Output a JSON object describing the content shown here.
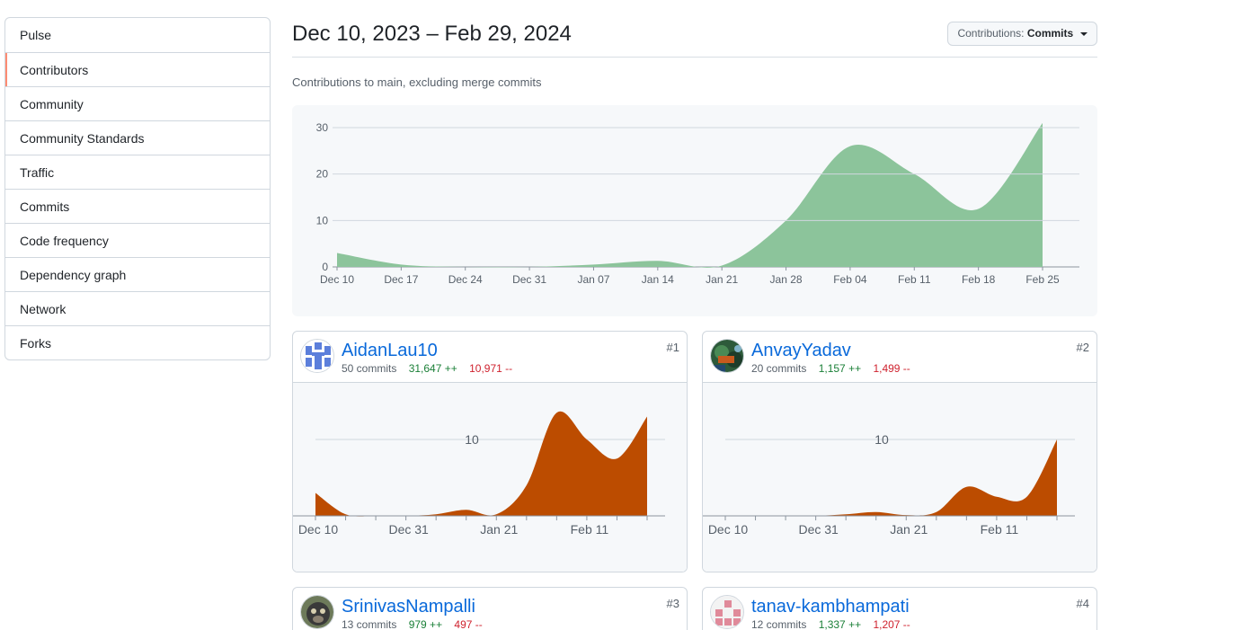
{
  "sidebar": {
    "items": [
      {
        "label": "Pulse"
      },
      {
        "label": "Contributors"
      },
      {
        "label": "Community"
      },
      {
        "label": "Community Standards"
      },
      {
        "label": "Traffic"
      },
      {
        "label": "Commits"
      },
      {
        "label": "Code frequency"
      },
      {
        "label": "Dependency graph"
      },
      {
        "label": "Network"
      },
      {
        "label": "Forks"
      }
    ],
    "selected": "Contributors"
  },
  "header": {
    "title": "Dec 10, 2023 – Feb 29, 2024",
    "contributions_label": "Contributions:",
    "contributions_value": "Commits",
    "subtitle": "Contributions to main, excluding merge commits"
  },
  "colors": {
    "main_area": "#8cc49b",
    "contributor_area": "#bc4c00",
    "selected_indicator": "#fd8c73",
    "additions": "#1a7f37",
    "deletions": "#cf222e",
    "link": "#0969da"
  },
  "chart_data": [
    {
      "type": "area",
      "x": [
        "Dec 10",
        "Dec 17",
        "Dec 24",
        "Dec 31",
        "Jan 07",
        "Jan 14",
        "Jan 21",
        "Jan 28",
        "Feb 04",
        "Feb 11",
        "Feb 18",
        "Feb 25"
      ],
      "y": [
        3,
        0.5,
        0,
        0,
        0.5,
        1.3,
        0.3,
        10,
        26,
        20,
        12.5,
        31
      ],
      "ylim": [
        0,
        30
      ],
      "yticks": [
        0,
        10,
        20,
        30
      ],
      "grid": true,
      "color": "#8cc49b"
    },
    {
      "type": "area",
      "contributor": "AidanLau10",
      "x": [
        "Dec 10",
        "Dec 17",
        "Dec 24",
        "Dec 31",
        "Jan 07",
        "Jan 14",
        "Jan 21",
        "Jan 28",
        "Feb 04",
        "Feb 11",
        "Feb 18",
        "Feb 25"
      ],
      "y": [
        3,
        0.2,
        0,
        0,
        0.2,
        0.8,
        0.2,
        4,
        13.5,
        10,
        7.5,
        13
      ],
      "xticks": [
        "Dec 10",
        "Dec 31",
        "Jan 21",
        "Feb 11"
      ],
      "yticks": [
        10
      ],
      "color": "#bc4c00"
    },
    {
      "type": "area",
      "contributor": "AnvayYadav",
      "x": [
        "Dec 10",
        "Dec 17",
        "Dec 24",
        "Dec 31",
        "Jan 07",
        "Jan 14",
        "Jan 21",
        "Jan 28",
        "Feb 04",
        "Feb 11",
        "Feb 18",
        "Feb 25"
      ],
      "y": [
        0,
        0,
        0,
        0,
        0.2,
        0.5,
        0.1,
        0.5,
        3.8,
        2.5,
        2.5,
        10
      ],
      "xticks": [
        "Dec 10",
        "Dec 31",
        "Jan 21",
        "Feb 11"
      ],
      "yticks": [
        10
      ],
      "color": "#bc4c00"
    }
  ],
  "contributors": [
    {
      "name": "AidanLau10",
      "commits": "50 commits",
      "additions": "31,647 ++",
      "deletions": "10,971 --",
      "rank": "#1",
      "avatar": "identicon-blue-icon"
    },
    {
      "name": "AnvayYadav",
      "commits": "20 commits",
      "additions": "1,157 ++",
      "deletions": "1,499 --",
      "rank": "#2",
      "avatar": "photo-avatar-icon"
    },
    {
      "name": "SrinivasNampalli",
      "commits": "13 commits",
      "additions": "979 ++",
      "deletions": "497 --",
      "rank": "#3",
      "avatar": "photo-avatar-icon"
    },
    {
      "name": "tanav-kambhampati",
      "commits": "12 commits",
      "additions": "1,337 ++",
      "deletions": "1,207 --",
      "rank": "#4",
      "avatar": "identicon-pink-icon"
    }
  ]
}
